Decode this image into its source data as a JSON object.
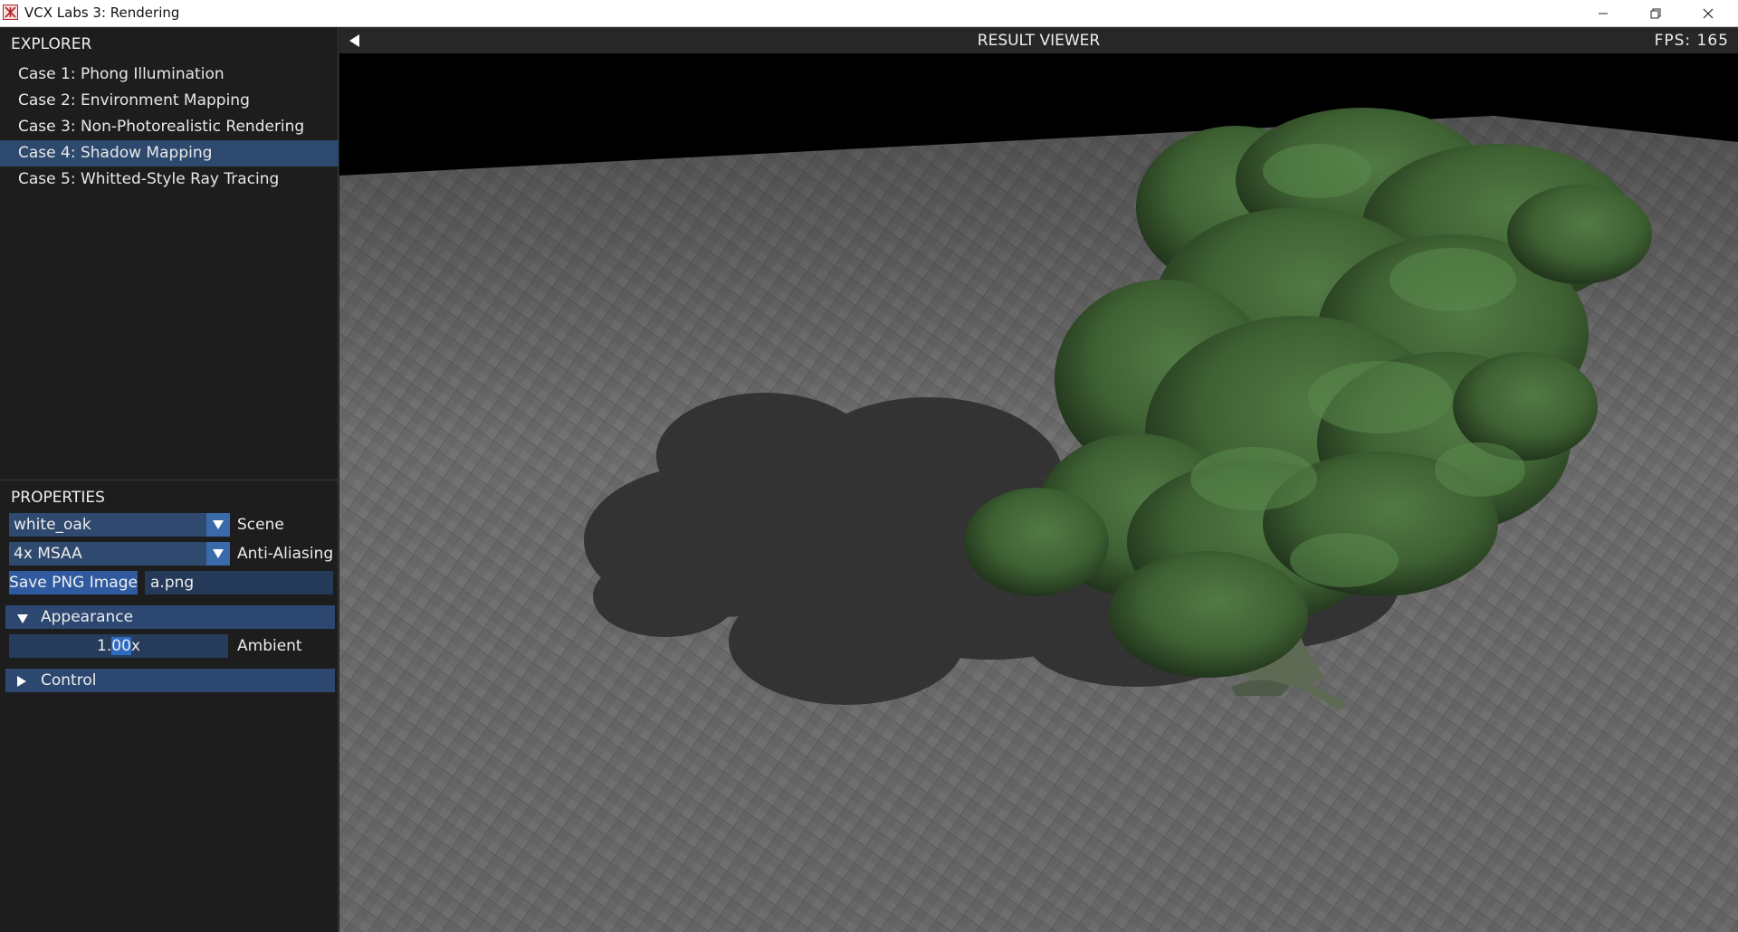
{
  "window": {
    "title": "VCX Labs 3: Rendering",
    "icon": "app-logo-icon",
    "controls": [
      "minimize-icon",
      "restore-icon",
      "close-icon"
    ]
  },
  "explorer": {
    "title": "EXPLORER",
    "items": [
      {
        "label": "Case 1: Phong Illumination",
        "selected": false
      },
      {
        "label": "Case 2: Environment Mapping",
        "selected": false
      },
      {
        "label": "Case 3: Non-Photorealistic Rendering",
        "selected": false
      },
      {
        "label": "Case 4: Shadow Mapping",
        "selected": true
      },
      {
        "label": "Case 5: Whitted-Style Ray Tracing",
        "selected": false
      }
    ]
  },
  "properties": {
    "title": "PROPERTIES",
    "scene": {
      "value": "white_oak",
      "label": "Scene"
    },
    "anti_aliasing": {
      "value": "4x MSAA",
      "label": "Anti-Aliasing"
    },
    "save_button": "Save PNG Image",
    "filename": "a.png",
    "appearance": {
      "label": "Appearance",
      "expanded": true,
      "ambient": {
        "value_before": "1.",
        "value_selected": "00",
        "value_after": "x",
        "label": "Ambient"
      }
    },
    "control": {
      "label": "Control",
      "expanded": false
    }
  },
  "viewer": {
    "title": "RESULT VIEWER",
    "fps": "FPS: 165",
    "colors": {
      "floor": "#6f6f6f",
      "background": "#000000",
      "foliage": "#3f6233",
      "shadow": "#303030"
    }
  }
}
